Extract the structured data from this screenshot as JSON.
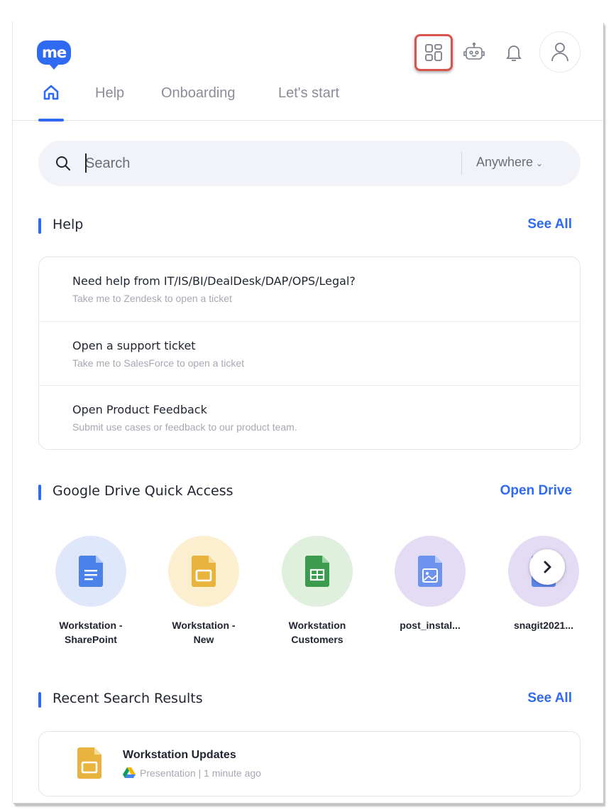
{
  "header": {
    "logo_text": "me",
    "icons": [
      "apps-grid-icon",
      "bot-icon",
      "bell-icon",
      "user-icon"
    ]
  },
  "tabs": [
    {
      "label": "",
      "icon": "home-icon"
    },
    {
      "label": "Help"
    },
    {
      "label": "Onboarding"
    },
    {
      "label": "Let's start"
    }
  ],
  "search": {
    "placeholder": "Search",
    "value": "",
    "scope": "Anywhere"
  },
  "help": {
    "title": "Help",
    "link": "See All",
    "items": [
      {
        "title": "Need help from IT/IS/BI/DealDesk/DAP/OPS/Legal?",
        "subtitle": "Take me to Zendesk to open a ticket"
      },
      {
        "title": "Open a support ticket",
        "subtitle": "Take me to SalesForce to open a ticket"
      },
      {
        "title": "Open Product Feedback",
        "subtitle": "Submit use cases or feedback to our product team."
      }
    ]
  },
  "drive": {
    "title": "Google Drive Quick Access",
    "link": "Open Drive",
    "items": [
      {
        "name": "Workstation - SharePoint",
        "type": "doc",
        "circle": "#dfe8fb",
        "color": "#4a82ea"
      },
      {
        "name": "Workstation - New",
        "type": "slides",
        "circle": "#fcefcf",
        "color": "#e8b43e"
      },
      {
        "name": "Workstation Customers",
        "type": "sheet",
        "circle": "#dff0dd",
        "color": "#3b9b4f"
      },
      {
        "name": "post_instal...",
        "type": "image",
        "circle": "#e4dcf5",
        "color": "#6e93ef"
      },
      {
        "name": "snagit2021...",
        "type": "file",
        "circle": "#e4dcf5",
        "color": "#5c87ec"
      }
    ]
  },
  "recent": {
    "title": "Recent Search Results",
    "link": "See All",
    "items": [
      {
        "title": "Workstation Updates",
        "meta": "Presentation | 1 minute ago",
        "icon": "slides-icon"
      }
    ]
  },
  "colors": {
    "accent": "#2f6bf2",
    "highlight": "#d9534f"
  }
}
